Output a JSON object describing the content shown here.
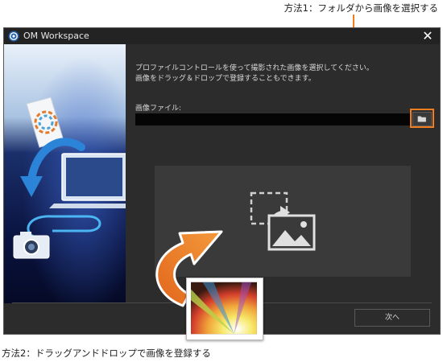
{
  "annotations": {
    "method1": "方法1：フォルダから画像を選択する",
    "method2": "方法2：ドラッグアンドドロップで画像を登録する"
  },
  "window": {
    "title": "OM Workspace",
    "close_icon": "close-icon"
  },
  "main": {
    "instruction_line1": "プロファイルコントロールを使って撮影された画像を選択してください。",
    "instruction_line2": "画像をドラッグ＆ドロップで登録することもできます。",
    "file_label": "画像ファイル:",
    "file_value": "",
    "browse_icon": "folder-icon",
    "drop_icon": "image-drop-icon"
  },
  "footer": {
    "next_label": "次へ"
  },
  "colors": {
    "accent_orange": "#f07d1e",
    "window_bg": "#2c2c2c",
    "drop_zone_bg": "#3a3a3a"
  }
}
